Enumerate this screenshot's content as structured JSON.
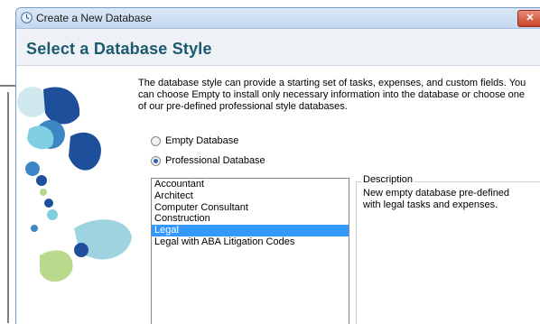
{
  "window": {
    "title": "Create a New Database",
    "close_label": "✕"
  },
  "header": {
    "heading": "Select a Database Style"
  },
  "intro": {
    "text": "The database style can provide a starting set of tasks, expenses, and custom fields. You can choose Empty to install only necessary information into the database or choose one of our pre-defined professional style databases."
  },
  "options": {
    "empty_label": "Empty Database",
    "professional_label": "Professional Database",
    "selected": "professional"
  },
  "styles": {
    "items": [
      "Accountant",
      "Architect",
      "Computer Consultant",
      "Construction",
      "Legal",
      "Legal with ABA Litigation Codes"
    ],
    "selected_index": 4
  },
  "description": {
    "legend": "Description",
    "text": "New empty database pre-defined with legal tasks and expenses."
  },
  "colors": {
    "heading": "#1b5a6e",
    "selection": "#3399ff",
    "art_teal": "#7fcfe0",
    "art_blue": "#1e4f9b",
    "art_green": "#b9d98c"
  },
  "icons": {
    "app": "clock-icon",
    "close": "close-icon"
  }
}
